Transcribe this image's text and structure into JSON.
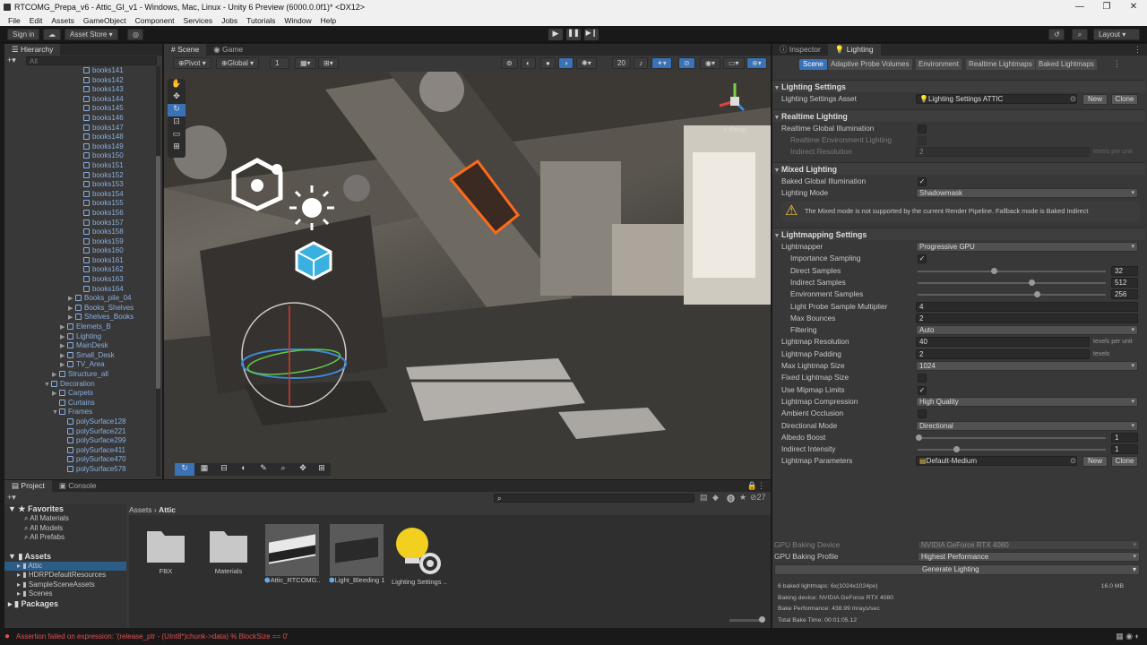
{
  "window": {
    "title": "RTCOMG_Prepa_v6 - Attic_GI_v1 - Windows, Mac, Linux - Unity 6 Preview (6000.0.0f1)* <DX12>"
  },
  "menu": [
    "File",
    "Edit",
    "Assets",
    "GameObject",
    "Component",
    "Services",
    "Jobs",
    "Tutorials",
    "Window",
    "Help"
  ],
  "toolbar": {
    "sign_in": "Sign in",
    "asset_store": "Asset Store ▾",
    "layout": "Layout"
  },
  "hierarchy": {
    "tab": "Hierarchy",
    "search_placeholder": "All",
    "rows": [
      {
        "label": "books141",
        "indent": 4,
        "kind": "item"
      },
      {
        "label": "books142",
        "indent": 4,
        "kind": "item"
      },
      {
        "label": "books143",
        "indent": 4,
        "kind": "item"
      },
      {
        "label": "books144",
        "indent": 4,
        "kind": "item"
      },
      {
        "label": "books145",
        "indent": 4,
        "kind": "item"
      },
      {
        "label": "books146",
        "indent": 4,
        "kind": "item"
      },
      {
        "label": "books147",
        "indent": 4,
        "kind": "item"
      },
      {
        "label": "books148",
        "indent": 4,
        "kind": "item"
      },
      {
        "label": "books149",
        "indent": 4,
        "kind": "item"
      },
      {
        "label": "books150",
        "indent": 4,
        "kind": "item"
      },
      {
        "label": "books151",
        "indent": 4,
        "kind": "item"
      },
      {
        "label": "books152",
        "indent": 4,
        "kind": "item"
      },
      {
        "label": "books153",
        "indent": 4,
        "kind": "item"
      },
      {
        "label": "books154",
        "indent": 4,
        "kind": "item"
      },
      {
        "label": "books155",
        "indent": 4,
        "kind": "item"
      },
      {
        "label": "books156",
        "indent": 4,
        "kind": "item"
      },
      {
        "label": "books157",
        "indent": 4,
        "kind": "item"
      },
      {
        "label": "books158",
        "indent": 4,
        "kind": "item"
      },
      {
        "label": "books159",
        "indent": 4,
        "kind": "item"
      },
      {
        "label": "books160",
        "indent": 4,
        "kind": "item"
      },
      {
        "label": "books161",
        "indent": 4,
        "kind": "item"
      },
      {
        "label": "books162",
        "indent": 4,
        "kind": "item"
      },
      {
        "label": "books163",
        "indent": 4,
        "kind": "item"
      },
      {
        "label": "books164",
        "indent": 4,
        "kind": "item"
      },
      {
        "label": "Books_pile_04",
        "indent": 3,
        "kind": "group"
      },
      {
        "label": "Books_Shelves",
        "indent": 3,
        "kind": "group"
      },
      {
        "label": "Shelves_Books",
        "indent": 3,
        "kind": "group"
      },
      {
        "label": "Elemets_B",
        "indent": 2,
        "kind": "group"
      },
      {
        "label": "Lighting",
        "indent": 2,
        "kind": "group"
      },
      {
        "label": "MainDesk",
        "indent": 2,
        "kind": "group"
      },
      {
        "label": "Small_Desk",
        "indent": 2,
        "kind": "group"
      },
      {
        "label": "TV_Area",
        "indent": 2,
        "kind": "group"
      },
      {
        "label": "Structure_all",
        "indent": 1,
        "kind": "group"
      },
      {
        "label": "Decoration",
        "indent": 0,
        "kind": "open"
      },
      {
        "label": "Carpets",
        "indent": 1,
        "kind": "group"
      },
      {
        "label": "Curtains",
        "indent": 1,
        "kind": "item"
      },
      {
        "label": "Frames",
        "indent": 1,
        "kind": "open"
      },
      {
        "label": "polySurface128",
        "indent": 2,
        "kind": "item"
      },
      {
        "label": "polySurface221",
        "indent": 2,
        "kind": "item"
      },
      {
        "label": "polySurface299",
        "indent": 2,
        "kind": "item"
      },
      {
        "label": "polySurface411",
        "indent": 2,
        "kind": "item"
      },
      {
        "label": "polySurface470",
        "indent": 2,
        "kind": "item"
      },
      {
        "label": "polySurface578",
        "indent": 2,
        "kind": "item"
      }
    ]
  },
  "scene": {
    "tabs": [
      "Scene",
      "Game"
    ],
    "pivot": "Pivot",
    "global": "Global",
    "grid_value": "1",
    "camera_speed": "20",
    "persp": "< Persp"
  },
  "inspector": {
    "tabs": [
      "Inspector",
      "Lighting"
    ],
    "subtabs": [
      "Scene",
      "Adaptive Probe Volumes",
      "Environment",
      "Realtime Lightmaps",
      "Baked Lightmaps"
    ],
    "lighting_settings": {
      "title": "Lighting Settings",
      "asset_label": "Lighting Settings Asset",
      "asset_value": "Lighting Settings ATTIC",
      "new": "New",
      "clone": "Clone"
    },
    "realtime": {
      "title": "Realtime Lighting",
      "rgi": "Realtime Global Illumination",
      "env": "Realtime Environment Lighting",
      "ind_res": "Indirect Resolution",
      "ind_res_val": "2",
      "unit": "texels per unit"
    },
    "mixed": {
      "title": "Mixed Lighting",
      "bgi": "Baked Global Illumination",
      "mode_label": "Lighting Mode",
      "mode_val": "Shadowmask",
      "warning": "The Mixed mode is not supported by the current Render Pipeline. Fallback mode is Baked Indirect"
    },
    "lightmapping": {
      "title": "Lightmapping Settings",
      "lightmapper": "Lightmapper",
      "lightmapper_val": "Progressive GPU",
      "importance": "Importance Sampling",
      "direct": "Direct Samples",
      "direct_val": "32",
      "direct_pct": 0.4,
      "indirect": "Indirect Samples",
      "indirect_val": "512",
      "indirect_pct": 0.6,
      "env": "Environment Samples",
      "env_val": "256",
      "env_pct": 0.63,
      "probe_mult": "Light Probe Sample Multiplier",
      "probe_mult_val": "4",
      "bounces": "Max Bounces",
      "bounces_val": "2",
      "filtering": "Filtering",
      "filtering_val": "Auto",
      "res": "Lightmap Resolution",
      "res_val": "40",
      "res_unit": "texels per unit",
      "padding": "Lightmap Padding",
      "padding_val": "2",
      "padding_unit": "texels",
      "max_size": "Max Lightmap Size",
      "max_size_val": "1024",
      "fixed": "Fixed Lightmap Size",
      "mipmap": "Use Mipmap Limits",
      "compression": "Lightmap Compression",
      "compression_val": "High Quality",
      "ao": "Ambient Occlusion",
      "dir_mode": "Directional Mode",
      "dir_mode_val": "Directional",
      "albedo": "Albedo Boost",
      "albedo_val": "1",
      "albedo_pct": 0.0,
      "indirect_int": "Indirect Intensity",
      "indirect_int_val": "1",
      "indirect_int_pct": 0.2,
      "params": "Lightmap Parameters",
      "params_val": "Default-Medium",
      "new": "New",
      "clone": "Clone"
    },
    "baking": {
      "gpu_device": "GPU Baking Device",
      "gpu_device_val": "NVIDIA GeForce RTX 4080",
      "gpu_profile": "GPU Baking Profile",
      "gpu_profile_val": "Highest Performance",
      "generate": "Generate Lighting",
      "stats": [
        "6 baked lightmaps: 6x(1024x1024px)",
        "Baking device: NVIDIA GeForce RTX 4080",
        "Bake Performance: 438.99 mrays/sec",
        "Total Bake Time: 00:01:05.12"
      ],
      "size": "16.0 MB"
    }
  },
  "project": {
    "tabs": [
      "Project",
      "Console"
    ],
    "favorites": "Favorites",
    "fav_items": [
      "All Materials",
      "All Models",
      "All Prefabs"
    ],
    "assets_root": "Assets",
    "asset_folders": [
      "Attic",
      "HDRPDefaultResources",
      "SampleSceneAssets",
      "Scenes"
    ],
    "packages": "Packages",
    "breadcrumb": [
      "Assets",
      "Attic"
    ],
    "count": "27",
    "items": [
      {
        "label": "FBX",
        "kind": "folder"
      },
      {
        "label": "Materials",
        "kind": "folder"
      },
      {
        "label": "Attic_RTCOMG...",
        "kind": "prefab"
      },
      {
        "label": "Light_Bleeding 1",
        "kind": "prefab2"
      },
      {
        "label": "Lighting Settings ...",
        "kind": "settings"
      }
    ]
  },
  "status": {
    "error": "Assertion failed on expression: '(release_ptr - (UInt8*)chunk->data) % BlockSize == 0'"
  },
  "colors": {
    "accent": "#3a72b8",
    "error": "#e05050",
    "selection": "#2c5d87"
  }
}
